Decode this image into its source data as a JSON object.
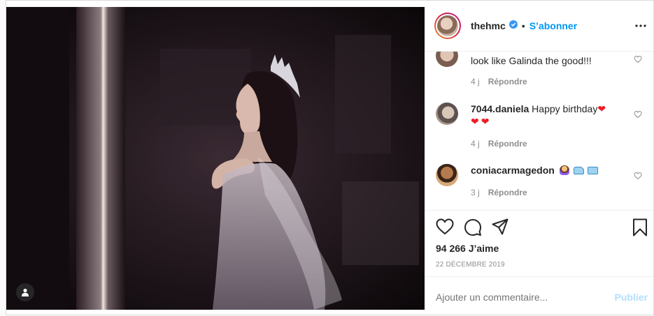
{
  "header": {
    "username": "thehmc",
    "separator": "•",
    "follow_label": "S’abonner"
  },
  "comments": [
    {
      "text": "look like Galinda the good!!!",
      "age": "4 j",
      "reply_label": "Répondre"
    },
    {
      "username": "7044.daniela",
      "text": "Happy birthday",
      "age": "4 j",
      "reply_label": "Répondre"
    },
    {
      "username": "coniacarmagedon",
      "age": "3 j",
      "reply_label": "Répondre"
    }
  ],
  "likes": "94 266 J’aime",
  "date": "22 DÉCEMBRE 2019",
  "add_comment": {
    "placeholder": "Ajouter un commentaire...",
    "publish_label": "Publier"
  },
  "colors": {
    "accent": "#0095f6",
    "text": "#262626",
    "muted": "#8e8e8e",
    "publish_disabled": "#b2dffc",
    "emoji_heart": "#ed1c24"
  },
  "icons": [
    "user-tag-icon",
    "verified-icon",
    "more-options-icon",
    "heart-icon",
    "comment-icon",
    "share-icon",
    "bookmark-icon",
    "red-heart-emoji",
    "woman-emoji",
    "train-emoji"
  ]
}
